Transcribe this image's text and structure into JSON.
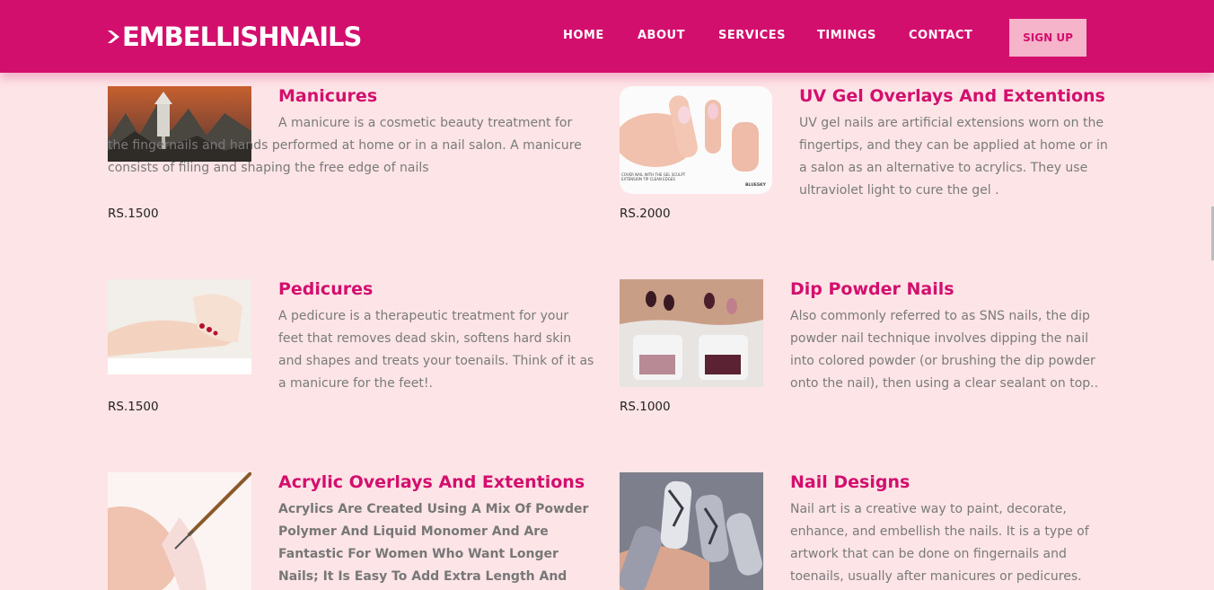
{
  "brand": {
    "logo_text": "EMBELLISHNAILS",
    "primary_color": "#d30f6e",
    "background_color": "#fde4e6"
  },
  "nav": {
    "items": [
      "HOME",
      "ABOUT",
      "SERVICES",
      "TIMINGS",
      "CONTACT"
    ],
    "signup_label": "SIGN UP"
  },
  "services": [
    {
      "title": "Manicures",
      "description": "A manicure is a cosmetic beauty treatment for the fingernails and hands performed at home or in a nail salon. A manicure consists of filing and shaping the free edge of nails",
      "price": "RS.1500",
      "image_icon": "manicure-scene-image"
    },
    {
      "title": "UV Gel Overlays And Extentions",
      "description": "UV gel nails are artificial extensions worn on the fingertips, and they can be applied at home or in a salon as an alternative to acrylics. They use ultraviolet light to cure the gel .",
      "price": "RS.2000",
      "image_icon": "gel-extension-image",
      "image_caption": "COVER NAIL WITH THE GEL SCULPT EXTENSION TIP CLEAN EDGES",
      "image_brand": "BLUESKY"
    },
    {
      "title": "Pedicures",
      "description": "A pedicure is a therapeutic treatment for your feet that removes dead skin, softens hard skin and shapes and treats your toenails. Think of it as a manicure for the feet!.",
      "price": "RS.1500",
      "image_icon": "pedicure-image"
    },
    {
      "title": "Dip Powder Nails",
      "description": "Also commonly referred to as SNS nails, the dip powder nail technique involves dipping the nail into colored powder (or brushing the dip powder onto the nail), then using a clear sealant on top..",
      "price": "RS.1000",
      "image_icon": "dip-powder-image"
    },
    {
      "title": "Acrylic Overlays And Extentions",
      "description": "Acrylics Are Created Using A Mix Of Powder Polymer And Liquid Monomer And Are Fantastic For Women Who Want Longer Nails; It Is Easy To Add Extra Length And Choose From Various Nail",
      "image_icon": "acrylic-image"
    },
    {
      "title": "Nail Designs",
      "description": "Nail art is a creative way to paint, decorate, enhance, and embellish the nails. It is a type of artwork that can be done on fingernails and toenails, usually after manicures or pedicures.",
      "image_icon": "nail-art-image"
    }
  ]
}
